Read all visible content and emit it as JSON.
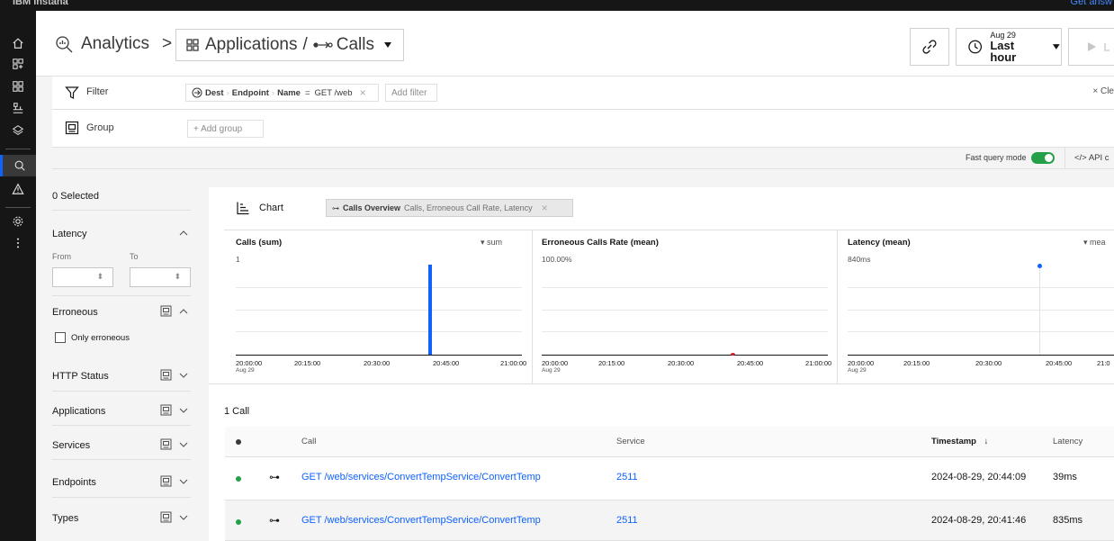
{
  "topbar": {
    "brand": "IBM Instana",
    "right_link": "Get answ"
  },
  "breadcrumb": {
    "root": "Analytics",
    "separator": ">",
    "applications": "Applications",
    "slash": "/",
    "view": "Calls"
  },
  "time": {
    "date": "Aug 29",
    "range": "Last hour"
  },
  "filter": {
    "label": "Filter",
    "chip_dest": "Dest",
    "chip_endpoint": "Endpoint",
    "chip_name": "Name",
    "chip_operator": "=",
    "chip_value": "GET /web",
    "add_filter": "Add filter",
    "clear": "× Cle"
  },
  "group": {
    "label": "Group",
    "add_group": "+ Add group"
  },
  "fast_query": {
    "label": "Fast query mode",
    "api": "</> API c",
    "enabled": true
  },
  "sidebar": {
    "selected": "0 Selected",
    "latency": "Latency",
    "from": "From",
    "to": "To",
    "erroneous": "Erroneous",
    "only_erroneous": "Only erroneous",
    "http_status": "HTTP Status",
    "applications": "Applications",
    "services": "Services",
    "endpoints": "Endpoints",
    "types": "Types"
  },
  "chart_header": {
    "label": "Chart",
    "overview_name": "Calls Overview",
    "overview_metrics": "Calls, Erroneous Call Rate, Latency"
  },
  "chart_data": [
    {
      "type": "bar",
      "title": "Calls (sum)",
      "aggregation": "sum",
      "ymax_label": "1",
      "x_ticks": [
        "20:00:00",
        "20:15:00",
        "20:30:00",
        "20:45:00",
        "21:00:00"
      ],
      "x_first_sub": "Aug 29",
      "series": [
        {
          "x": "20:44",
          "value": 1
        }
      ],
      "color": "#0f62fe"
    },
    {
      "type": "line",
      "title": "Erroneous Calls Rate (mean)",
      "ymax_label": "100.00%",
      "x_ticks": [
        "20:00:00",
        "20:15:00",
        "20:30:00",
        "20:45:00",
        "21:00:00"
      ],
      "x_first_sub": "Aug 29",
      "series": [
        {
          "x": "20:41",
          "value": 0
        }
      ],
      "color": "#da1e28"
    },
    {
      "type": "scatter",
      "title": "Latency (mean)",
      "aggregation": "mea",
      "ymax_label": "840ms",
      "x_ticks": [
        "20:00:00",
        "20:15:00",
        "20:30:00",
        "20:45:00",
        "21:0"
      ],
      "x_first_sub": "Aug 29",
      "series": [
        {
          "x": "20:41",
          "value": 835
        }
      ],
      "color": "#0f62fe"
    }
  ],
  "calls": {
    "count_label": "1 Call",
    "headers": {
      "call": "Call",
      "service": "Service",
      "timestamp": "Timestamp",
      "latency": "Latency"
    },
    "rows": [
      {
        "call": "GET /web/services/ConvertTempService/ConvertTemp",
        "service": "2511",
        "timestamp": "2024-08-29, 20:44:09",
        "latency": "39ms"
      },
      {
        "call": "GET /web/services/ConvertTempService/ConvertTemp",
        "service": "2511",
        "timestamp": "2024-08-29, 20:41:46",
        "latency": "835ms"
      }
    ]
  }
}
